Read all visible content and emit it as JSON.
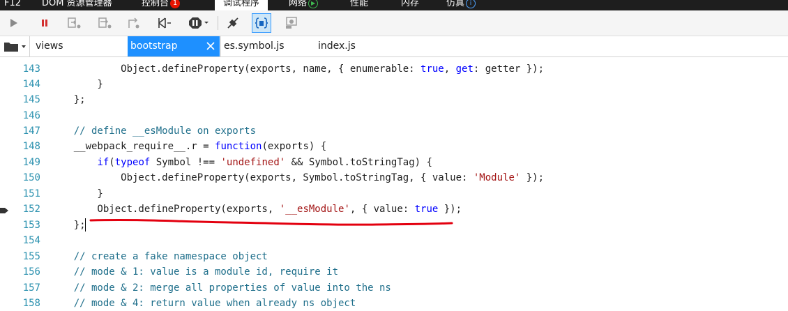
{
  "top_tabs": [
    {
      "label": "F12"
    },
    {
      "label": "DOM 资源管理器"
    },
    {
      "label": "控制台",
      "badge": "1"
    },
    {
      "label": "调试程序"
    },
    {
      "label": "网络"
    },
    {
      "label": "性能"
    },
    {
      "label": "内存"
    },
    {
      "label": "仿真"
    }
  ],
  "toolbar": {
    "icons": [
      "continue-icon",
      "break-icon",
      "step-into-icon",
      "step-over-icon",
      "step-out-icon",
      "break-on-new-worker-icon",
      "exception-behavior-icon",
      "disconnect-icon",
      "pretty-print-icon",
      "just-my-code-icon"
    ]
  },
  "file_tabs": [
    {
      "label": "views"
    },
    {
      "label": "bootstrap",
      "active": true
    },
    {
      "label": "es.symbol.js"
    },
    {
      "label": "index.js"
    }
  ],
  "code": {
    "lines": [
      {
        "n": "143"
      },
      {
        "n": "144"
      },
      {
        "n": "145"
      },
      {
        "n": "146"
      },
      {
        "n": "147"
      },
      {
        "n": "148"
      },
      {
        "n": "149"
      },
      {
        "n": "150"
      },
      {
        "n": "151"
      },
      {
        "n": "152"
      },
      {
        "n": "153"
      },
      {
        "n": "154"
      },
      {
        "n": "155"
      },
      {
        "n": "156"
      },
      {
        "n": "157"
      },
      {
        "n": "158"
      }
    ],
    "t": {
      "l143": {
        "a": "            Object.defineProperty(exports, name, { enumerable: ",
        "k1": "true",
        "b": ", ",
        "k2": "get",
        "c": ": getter });"
      },
      "l144": "        }",
      "l145": "    };",
      "l147": "    // define __esModule on exports",
      "l148": {
        "a": "    __webpack_require__.r = ",
        "k": "function",
        "b": "(exports) {"
      },
      "l149": {
        "k1": "if",
        "a": "(",
        "k2": "typeof",
        "b": " Symbol !== ",
        "s": "'undefined'",
        "c": " && Symbol.toStringTag) {"
      },
      "l150": {
        "a": "            Object.defineProperty(exports, Symbol.toStringTag, { value: ",
        "s": "'Module'",
        "b": " });"
      },
      "l151": "        }",
      "l152": {
        "a": "        Object.defineProperty(exports, ",
        "s": "'__esModule'",
        "b": ", { value: ",
        "k": "true",
        "c": " });"
      },
      "l153": "    };",
      "l155": "    // create a fake namespace object",
      "l156": "    // mode & 1: value is a module id, require it",
      "l157": "    // mode & 2: merge all properties of value into the ns",
      "l158": "    // mode & 4: return value when already ns object"
    }
  },
  "colors": {
    "keyword": "#0000ff",
    "string": "#a31515",
    "comment": "#1f6f8b",
    "line_number": "#2b91af",
    "active_tab": "#1e90ff",
    "annotation": "#e3000f"
  }
}
